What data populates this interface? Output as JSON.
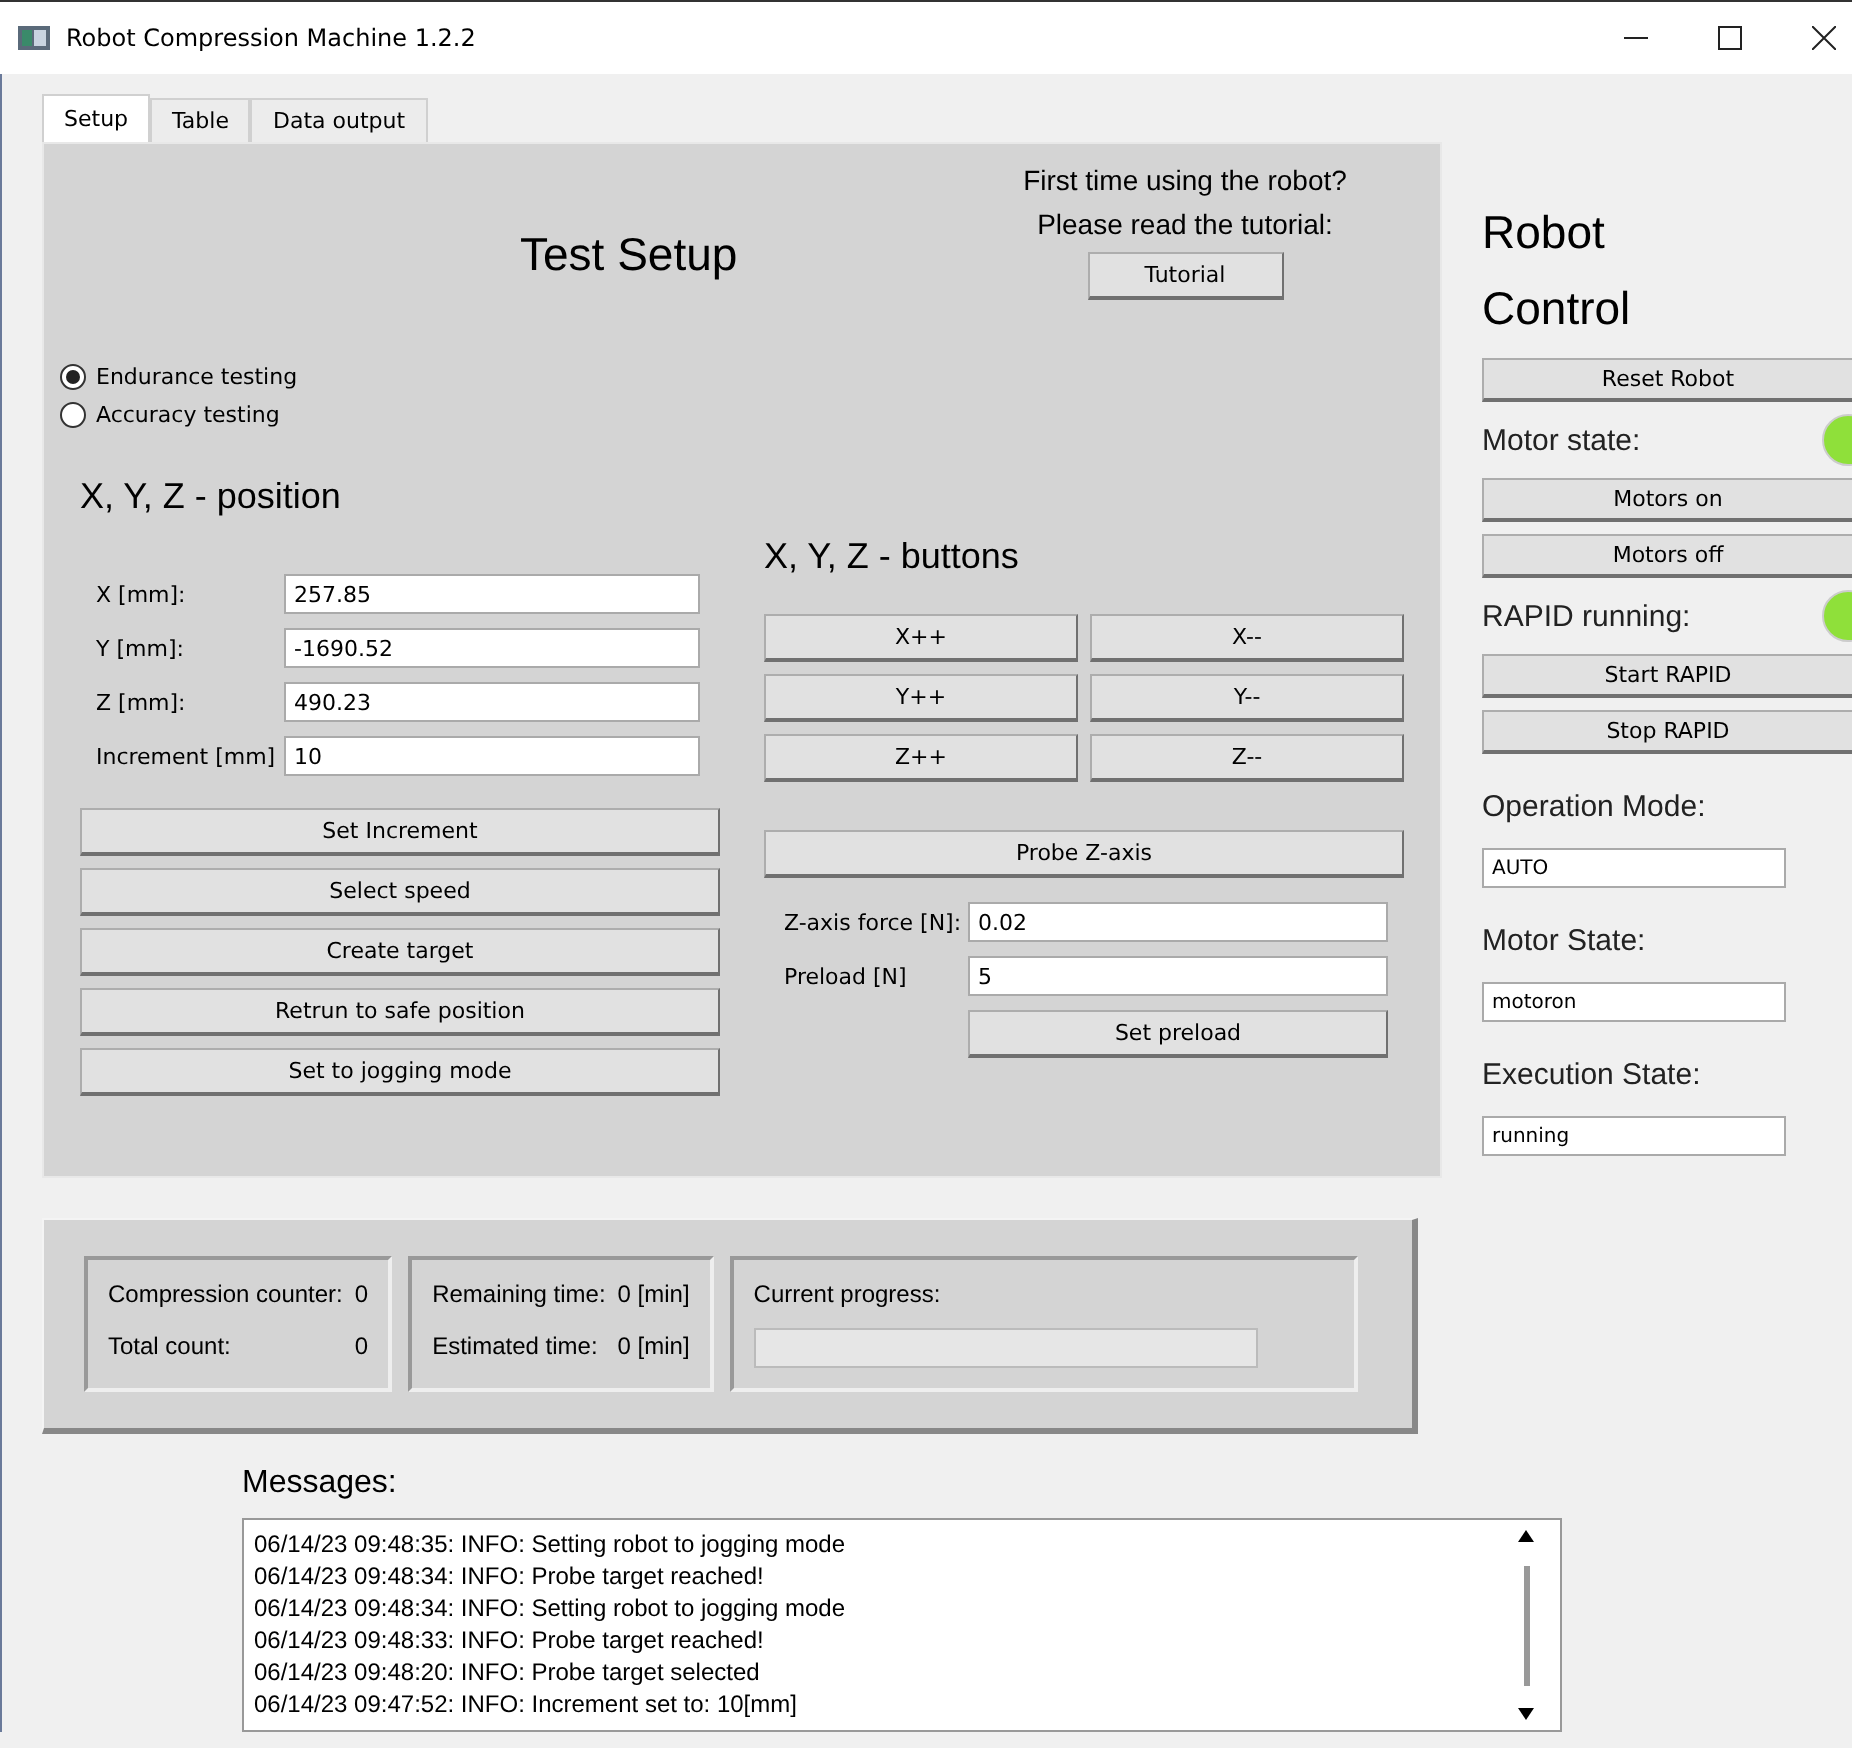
{
  "window": {
    "title": "Robot Compression Machine 1.2.2"
  },
  "tabs": [
    {
      "label": "Setup",
      "selected": true
    },
    {
      "label": "Table",
      "selected": false
    },
    {
      "label": "Data output",
      "selected": false
    }
  ],
  "setup": {
    "title": "Test Setup",
    "tutorial_prompt": [
      "First time using the robot?",
      "Please read the tutorial:"
    ],
    "tutorial_button": "Tutorial",
    "test_modes": [
      {
        "label": "Endurance testing",
        "selected": true
      },
      {
        "label": "Accuracy testing",
        "selected": false
      }
    ],
    "position": {
      "title": "X, Y, Z - position",
      "fields": [
        {
          "label": "X [mm]:",
          "value": "257.85"
        },
        {
          "label": "Y [mm]:",
          "value": "-1690.52"
        },
        {
          "label": "Z [mm]:",
          "value": "490.23"
        },
        {
          "label": "Increment [mm]",
          "value": "10"
        }
      ],
      "buttons": [
        "Set Increment",
        "Select speed",
        "Create target",
        "Retrun to safe position",
        "Set to jogging mode"
      ]
    },
    "jog": {
      "title": "X, Y, Z - buttons",
      "buttons": [
        "X++",
        "X--",
        "Y++",
        "Y--",
        "Z++",
        "Z--"
      ],
      "probe_button": "Probe Z-axis",
      "fields": [
        {
          "label": "Z-axis force [N]:",
          "value": "0.02"
        },
        {
          "label": "Preload [N]",
          "value": "5"
        }
      ],
      "preload_button": "Set preload"
    }
  },
  "status": {
    "compression_counter": {
      "label": "Compression counter:",
      "value": "0"
    },
    "total_count": {
      "label": "Total count:",
      "value": "0"
    },
    "remaining_time": {
      "label": "Remaining time:",
      "value": "0 [min]"
    },
    "estimated_time": {
      "label": "Estimated time:",
      "value": "0 [min]"
    },
    "progress": {
      "label": "Current progress:",
      "level": 0
    }
  },
  "messages": {
    "label": "Messages:",
    "lines": [
      "06/14/23 09:48:35: INFO: Setting robot to jogging mode",
      "06/14/23 09:48:34: INFO: Probe target reached!",
      "06/14/23 09:48:34: INFO: Setting robot to jogging mode",
      "06/14/23 09:48:33: INFO: Probe target reached!",
      "06/14/23 09:48:20: INFO: Probe target selected",
      "06/14/23 09:47:52: INFO: Increment set to: 10[mm]"
    ]
  },
  "robot_control": {
    "title": [
      "Robot",
      "Control"
    ],
    "reset_button": "Reset Robot",
    "motor_state": {
      "label": "Motor state:",
      "color": "#8fe03a",
      "buttons": [
        "Motors on",
        "Motors off"
      ]
    },
    "rapid": {
      "label": "RAPID running:",
      "color": "#8fe03a",
      "buttons": [
        "Start RAPID",
        "Stop RAPID"
      ]
    },
    "fields": [
      {
        "label": "Operation Mode:",
        "value": "AUTO"
      },
      {
        "label": "Motor State:",
        "value": "motoron"
      },
      {
        "label": "Execution State:",
        "value": "running"
      }
    ]
  }
}
